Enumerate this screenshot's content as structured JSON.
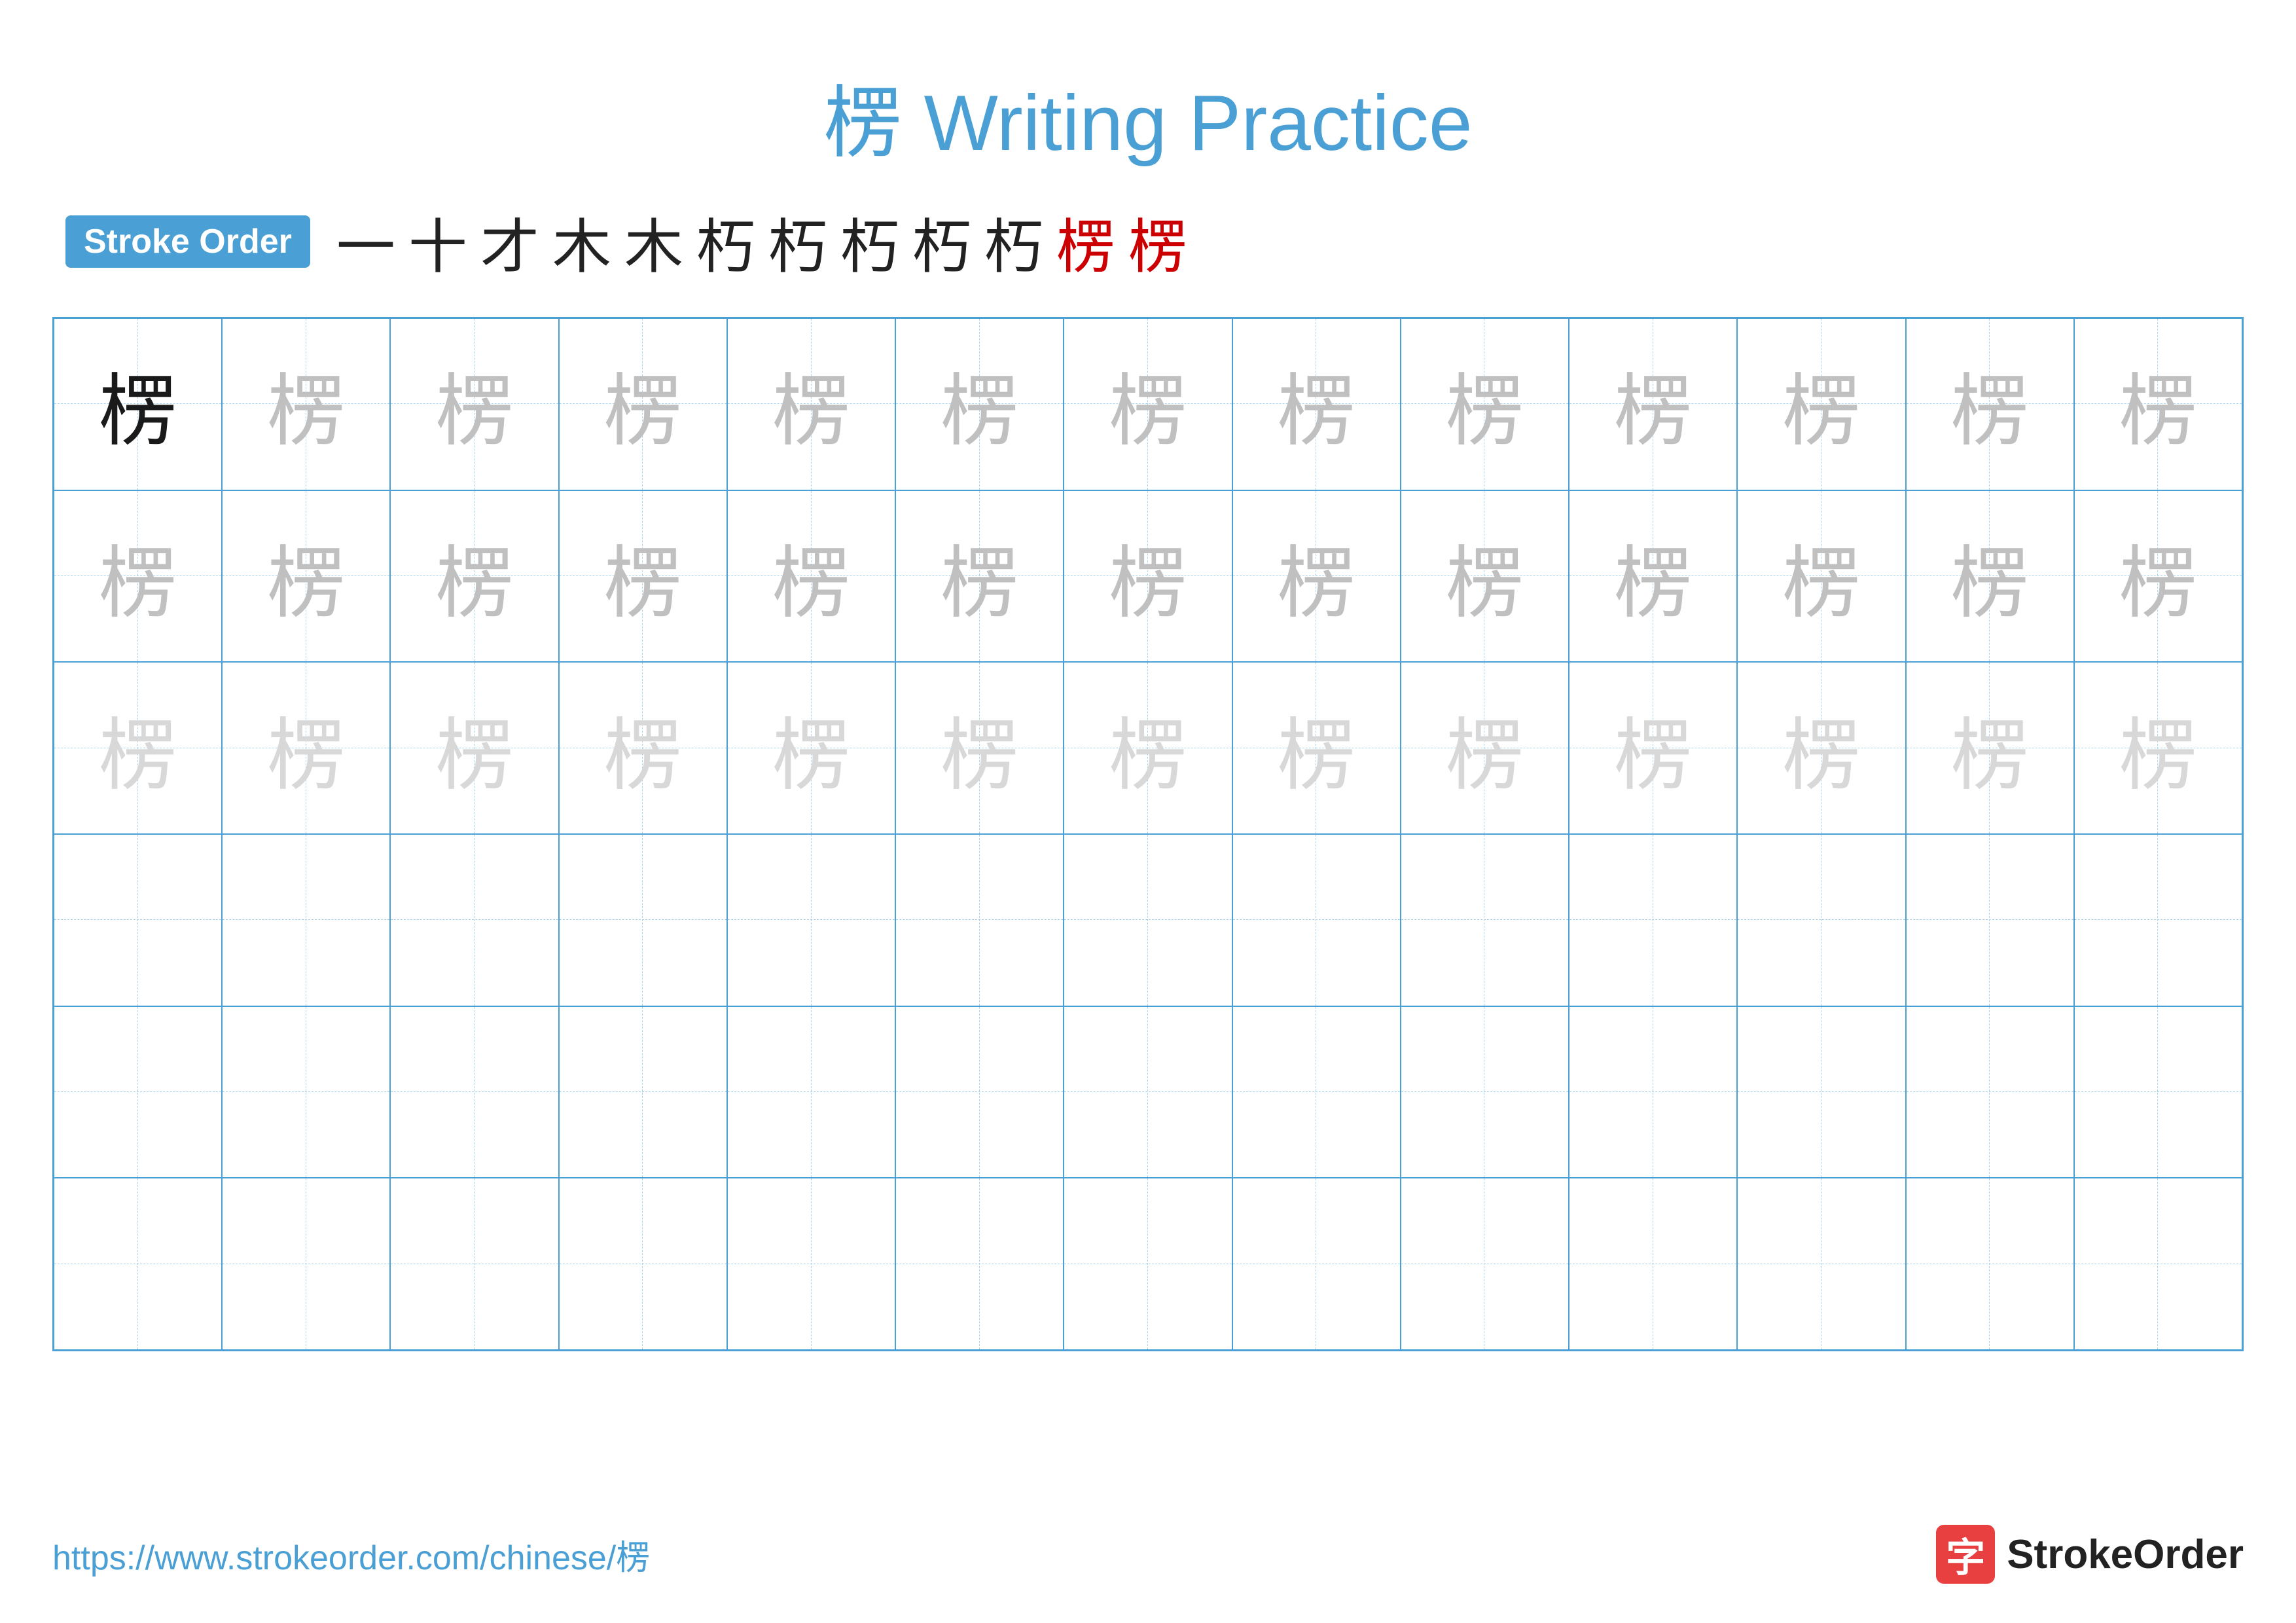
{
  "title": {
    "character": "楞",
    "label": "Writing Practice",
    "full": "楞 Writing Practice"
  },
  "stroke_order": {
    "badge_label": "Stroke Order",
    "strokes": [
      "一",
      "十",
      "才",
      "木",
      "木",
      "朽",
      "朽",
      "朽",
      "朽",
      "朽",
      "楞",
      "楞"
    ]
  },
  "grid": {
    "rows": 6,
    "cols": 13,
    "character": "楞",
    "row_styles": [
      "dark",
      "medium",
      "light",
      "empty",
      "empty",
      "empty"
    ]
  },
  "footer": {
    "url": "https://www.strokeorder.com/chinese/楞",
    "logo_text": "StrokeOrder",
    "logo_icon": "字"
  }
}
